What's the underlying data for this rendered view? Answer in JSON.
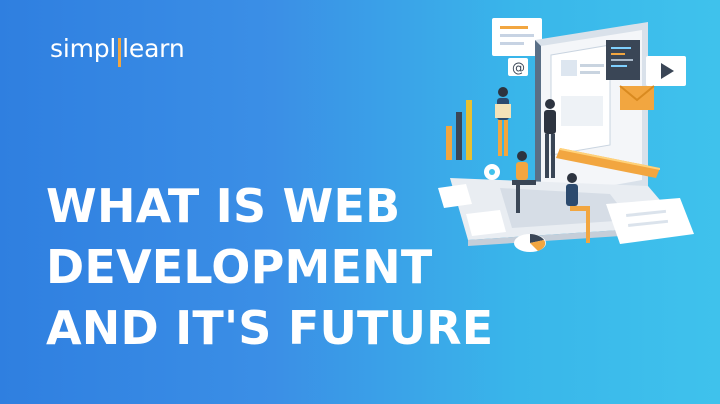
{
  "brand": {
    "logo_left": "simpl",
    "logo_right": "learn",
    "accent_color": "#f2a640"
  },
  "headline": {
    "lines": [
      "WHAT IS WEB",
      "DEVELOPMENT",
      "AND IT'S FUTURE"
    ]
  },
  "theme": {
    "background_left": "#2f7fe0",
    "background_right": "#3fc2ec",
    "text_color": "#ffffff"
  },
  "illustration": {
    "icons": [
      "laptop-icon",
      "browser-window-icon",
      "video-play-icon",
      "envelope-icon",
      "bar-chart-icon",
      "pie-chart-icon",
      "gear-icon",
      "ruler-icon",
      "at-sign-icon"
    ]
  }
}
